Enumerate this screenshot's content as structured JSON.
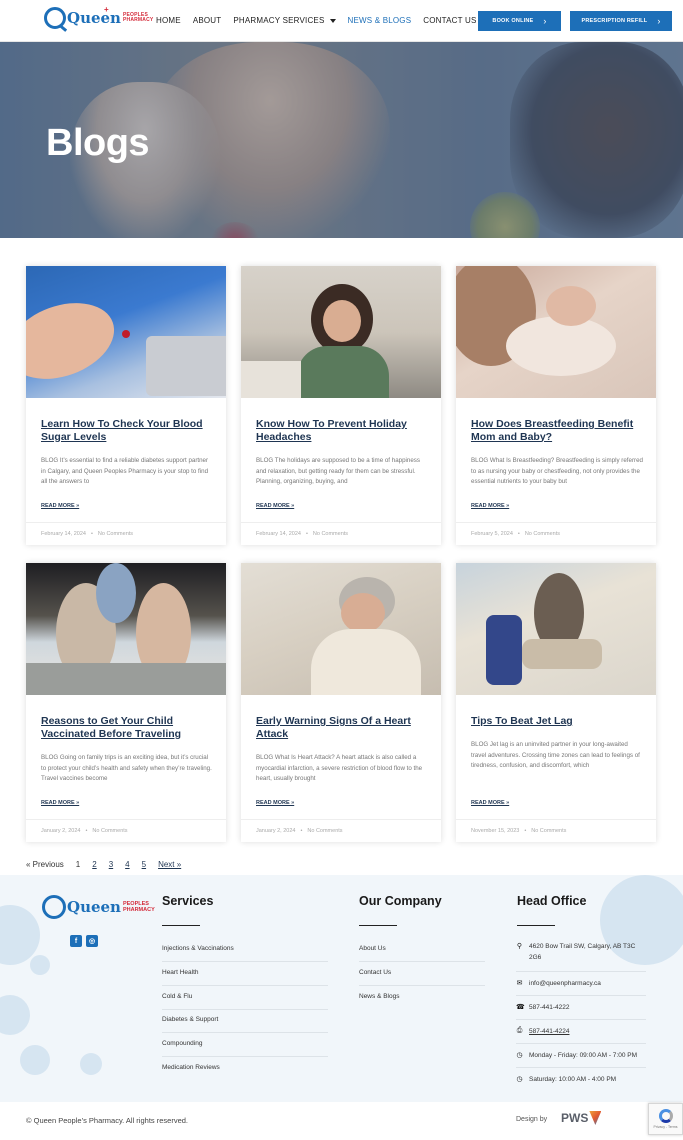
{
  "header": {
    "logo": {
      "wordmark": "Queen",
      "sub_top": "PEOPLES",
      "sub_bottom": "PHARMACY"
    },
    "nav": [
      {
        "label": "HOME"
      },
      {
        "label": "ABOUT"
      },
      {
        "label": "PHARMACY SERVICES"
      },
      {
        "label": "NEWS & BLOGS"
      },
      {
        "label": "CONTACT US"
      }
    ],
    "book_label": "BOOK ONLINE",
    "refill_label": "PRESCRIPTION REFILL"
  },
  "hero": {
    "title": "Blogs"
  },
  "posts": [
    {
      "title": "Learn How To Check Your Blood Sugar Levels",
      "excerpt": "BLOG It’s essential to find a reliable diabetes support partner in Calgary, and Queen Peoples Pharmacy is your stop to find all the answers to",
      "more": "READ MORE »",
      "date": "February 14, 2024",
      "comments": "No Comments"
    },
    {
      "title": "Know How To Prevent Holiday Headaches",
      "excerpt": "BLOG The holidays are supposed to be a time of happiness and relaxation, but getting ready for them can be stressful. Planning, organizing, buying, and",
      "more": "READ MORE »",
      "date": "February 14, 2024",
      "comments": "No Comments"
    },
    {
      "title": "How Does Breastfeeding Benefit Mom and Baby?",
      "excerpt": "BLOG What Is Breastfeeding? Breastfeeding is simply referred to as nursing your baby or chestfeeding, not only provides the essential nutrients to your baby but",
      "more": "READ MORE »",
      "date": "February 5, 2024",
      "comments": "No Comments"
    },
    {
      "title": "Reasons to Get Your Child Vaccinated Before Traveling",
      "excerpt": "BLOG Going on family trips is an exciting idea, but it’s crucial to protect your child’s health and safety when they’re traveling. Travel vaccines become",
      "more": "READ MORE »",
      "date": "January 2, 2024",
      "comments": "No Comments"
    },
    {
      "title": "Early Warning Signs Of a Heart Attack",
      "excerpt": "BLOG What Is Heart Attack? A heart attack is also called a myocardial infarction, a severe restriction of blood flow to the heart, usually brought",
      "more": "READ MORE »",
      "date": "January 2, 2024",
      "comments": "No Comments"
    },
    {
      "title": "Tips To Beat Jet Lag",
      "excerpt": "BLOG Jet lag is an uninvited partner in your long-awaited travel adventures. Crossing time zones can lead to feelings of tiredness, confusion, and discomfort, which",
      "more": "READ MORE »",
      "date": "November 15, 2023",
      "comments": "No Comments"
    }
  ],
  "pagination": {
    "prev": "« Previous",
    "pages": [
      "1",
      "2",
      "3",
      "4",
      "5"
    ],
    "next": "Next »"
  },
  "footer": {
    "services_heading": "Services",
    "services": [
      "Injections & Vaccinations",
      "Heart Health",
      "Cold & Flu",
      "Diabetes & Support",
      "Compounding",
      "Medication Reviews"
    ],
    "company_heading": "Our Company",
    "company": [
      "About Us",
      "Contact Us",
      "News & Blogs"
    ],
    "office_heading": "Head Office",
    "office": {
      "address": "4620 Bow Trail SW, Calgary, AB T3C 2G6",
      "email": "info@queenpharmacy.ca",
      "phone": "587-441-4222",
      "fax": "587-441-4224",
      "hours_weekday": "Monday - Friday: 09:00 AM - 7:00 PM",
      "hours_saturday": "Saturday: 10:00 AM - 4:00 PM"
    },
    "social": {
      "facebook": "f",
      "instagram": "◎"
    }
  },
  "bottom": {
    "copyright": "© Queen People’s Pharmacy. All rights reserved.",
    "design_by": "Design by",
    "agency": "PWS"
  },
  "recaptcha": {
    "terms": "Privacy - Terms"
  }
}
